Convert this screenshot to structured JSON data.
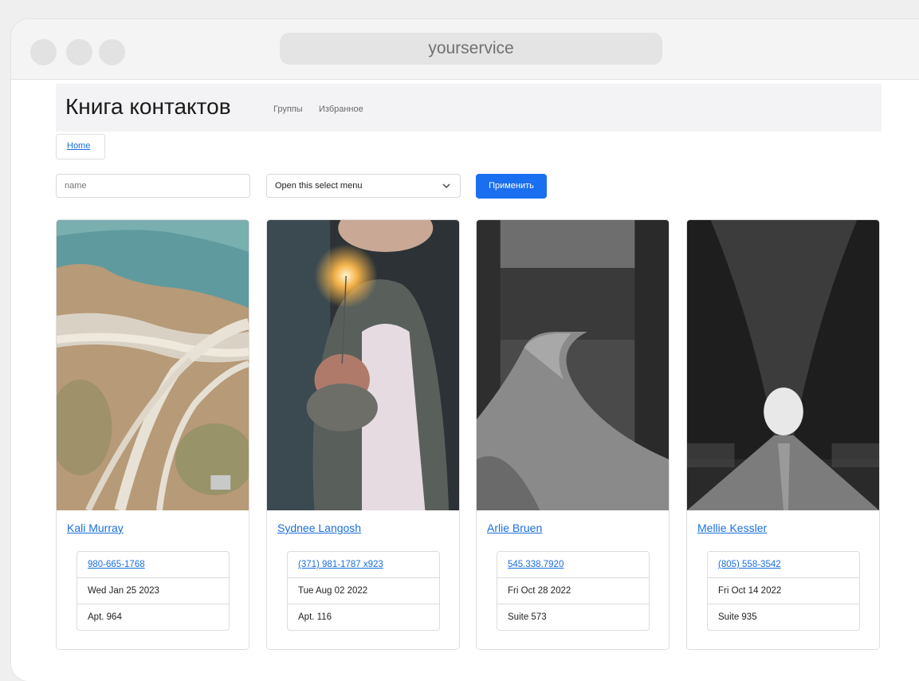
{
  "browser": {
    "url": "yourservice"
  },
  "navbar": {
    "brand": "Книга контактов",
    "links": [
      "Группы",
      "Избранное"
    ]
  },
  "breadcrumb": {
    "home": "Home"
  },
  "filters": {
    "name_placeholder": "name",
    "select_value": "Open this select menu",
    "apply_label": "Применить"
  },
  "colors": {
    "accent": "#1a6ff0",
    "link": "#1a6fe0"
  },
  "contacts": [
    {
      "name": "Kali Murray",
      "phone": "980-665-1768",
      "date": "Wed Jan 25 2023",
      "address": "Apt. 964"
    },
    {
      "name": "Sydnee Langosh",
      "phone": "(371) 981-1787 x923",
      "date": "Tue Aug 02 2022",
      "address": "Apt. 116"
    },
    {
      "name": "Arlie Bruen",
      "phone": "545.338.7920",
      "date": "Fri Oct 28 2022",
      "address": "Suite 573"
    },
    {
      "name": "Mellie Kessler",
      "phone": "(805) 558-3542",
      "date": "Fri Oct 14 2022",
      "address": "Suite 935"
    }
  ]
}
